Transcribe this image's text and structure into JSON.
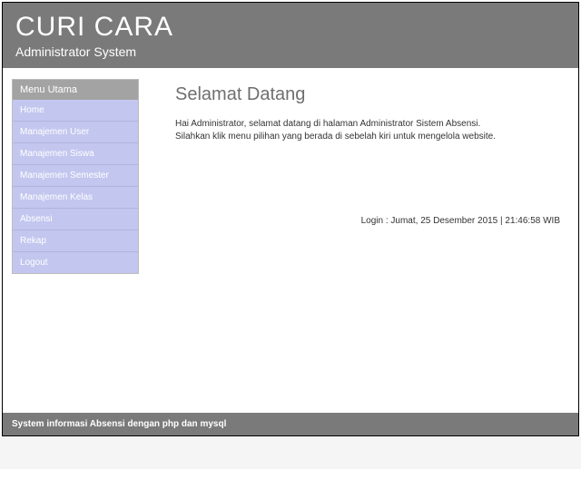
{
  "header": {
    "brand": "CURI CARA",
    "subtitle": "Administrator System"
  },
  "sidebar": {
    "title": "Menu Utama",
    "items": [
      {
        "label": "Home"
      },
      {
        "label": "Manajemen User"
      },
      {
        "label": "Manajemen Siswa"
      },
      {
        "label": "Manajemen Semester"
      },
      {
        "label": "Manajemen Kelas"
      },
      {
        "label": "Absensi"
      },
      {
        "label": "Rekap"
      },
      {
        "label": "Logout"
      }
    ]
  },
  "main": {
    "heading": "Selamat Datang",
    "line1": "Hai Administrator, selamat datang di halaman Administrator Sistem Absensi.",
    "line2": "Silahkan klik menu pilihan yang berada di sebelah kiri untuk mengelola website.",
    "login_label": "Login :",
    "login_value": "Jumat, 25 Desember 2015 | 21:46:58 WIB"
  },
  "footer": {
    "text": "System informasi Absensi dengan php dan mysql"
  }
}
